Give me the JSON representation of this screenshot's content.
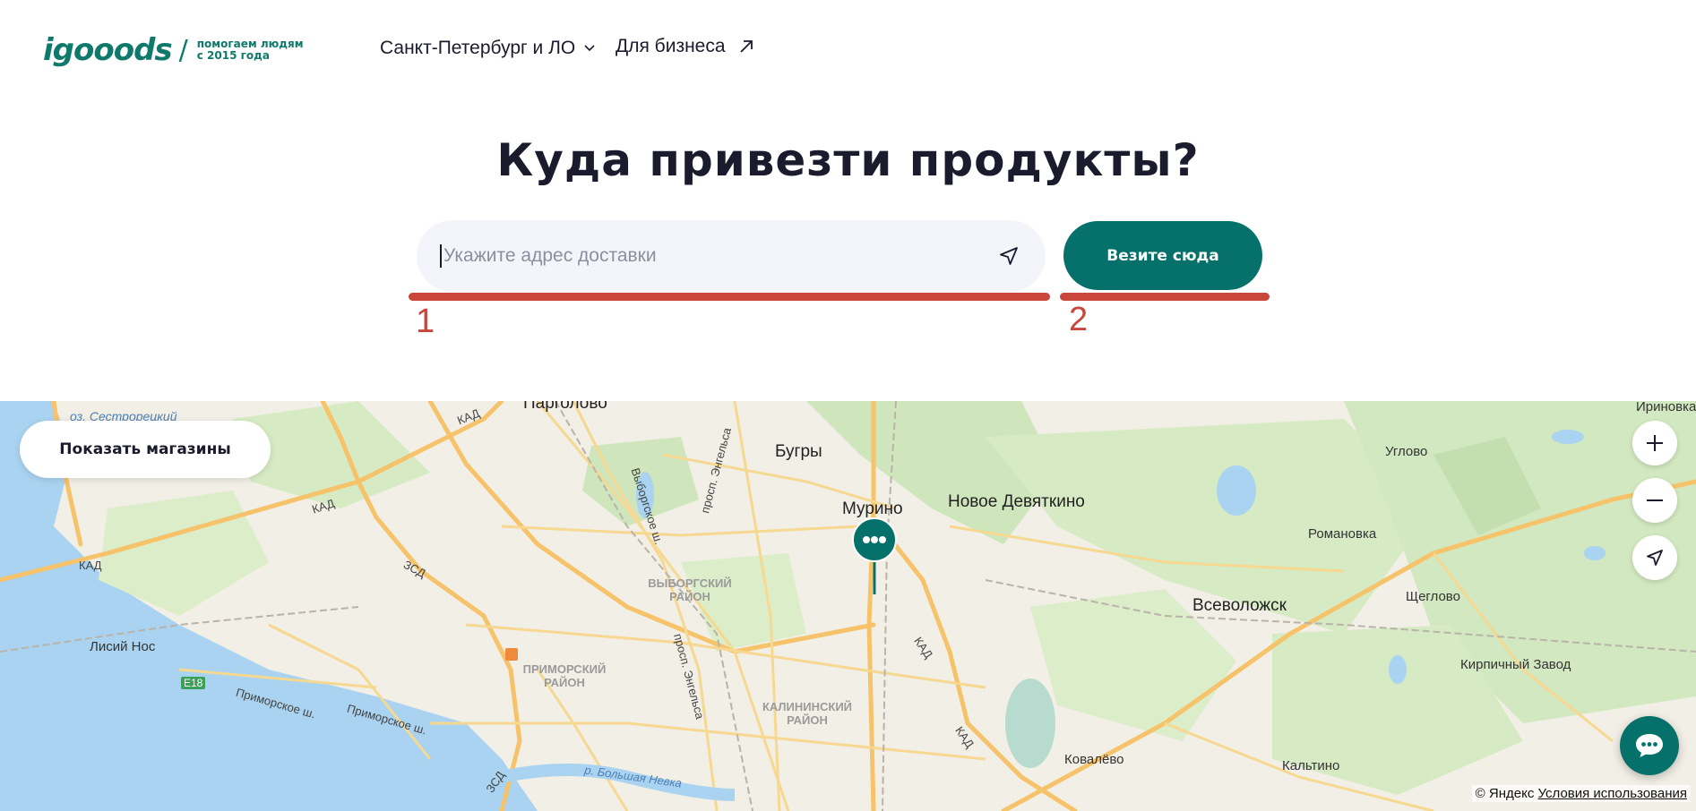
{
  "header": {
    "logo_text": "igooods",
    "logo_tagline_line1": "помогаем людям",
    "logo_tagline_line2": "с 2015 года",
    "city_label": "Санкт-Петербург и ЛО",
    "business_label": "Для бизнеса"
  },
  "hero": {
    "title": "Куда привезти продукты?",
    "address_placeholder": "Укажите адрес доставки",
    "address_value": "",
    "deliver_button": "Везите сюда"
  },
  "annotations": {
    "marker_1": "1",
    "marker_2": "2",
    "color": "#c9463d"
  },
  "map": {
    "show_shops_button": "Показать магазины",
    "labels": {
      "pargolovo": "Парголово",
      "bugry": "Бугры",
      "murino": "Мурино",
      "novoe_devyatkino": "Новое Девяткино",
      "irinovka": "Ириновка",
      "uglovo": "Углово",
      "romanovka": "Романовка",
      "vsevolozhsk": "Всеволожск",
      "shcheglovo": "Щеглово",
      "kirpichny_zavod": "Кирпичный Завод",
      "kovalevo": "Ковалёво",
      "kaltino": "Кальтино",
      "lisiy_nos": "Лисий Нос",
      "sestroretsky_lake": "оз. Сестрорецкий",
      "vyborgsky_district": "ВЫБОРГСКИЙ РАЙОН",
      "primorsky_district": "ПРИМОРСКИЙ РАЙОН",
      "kalininsky_district": "КАЛИНИНСКИЙ РАЙОН",
      "kad_1": "КАД",
      "kad_2": "КАД",
      "kad_3": "КАД",
      "kad_4": "КАД",
      "kad_5": "КАД",
      "zsd_1": "ЗСД",
      "zsd_2": "ЗСД",
      "e18": "E18",
      "vyborgskoe_sh": "Выборгское ш.",
      "prospekt_engelsa_1": "просп. Энгельса",
      "prospekt_engelsa_2": "просп. Энгельса",
      "primorskoe_sh_1": "Приморское ш.",
      "primorskoe_sh_2": "Приморское ш.",
      "bolshaya_nevka": "р. Большая Невка"
    },
    "copyright": "© Яндекс",
    "terms_link": "Условия использования"
  },
  "colors": {
    "brand": "#06716a",
    "text": "#1b1b2e",
    "input_bg": "#f4f5fb"
  },
  "icons": {
    "city_chevron": "chevron-down-icon",
    "business_arrow": "arrow-up-right-icon",
    "locate": "navigation-arrow-icon",
    "zoom_in": "plus-icon",
    "zoom_out": "minus-icon",
    "geolocation": "navigation-arrow-icon",
    "chat": "chat-bubble-icon",
    "pin": "map-pin-icon"
  }
}
